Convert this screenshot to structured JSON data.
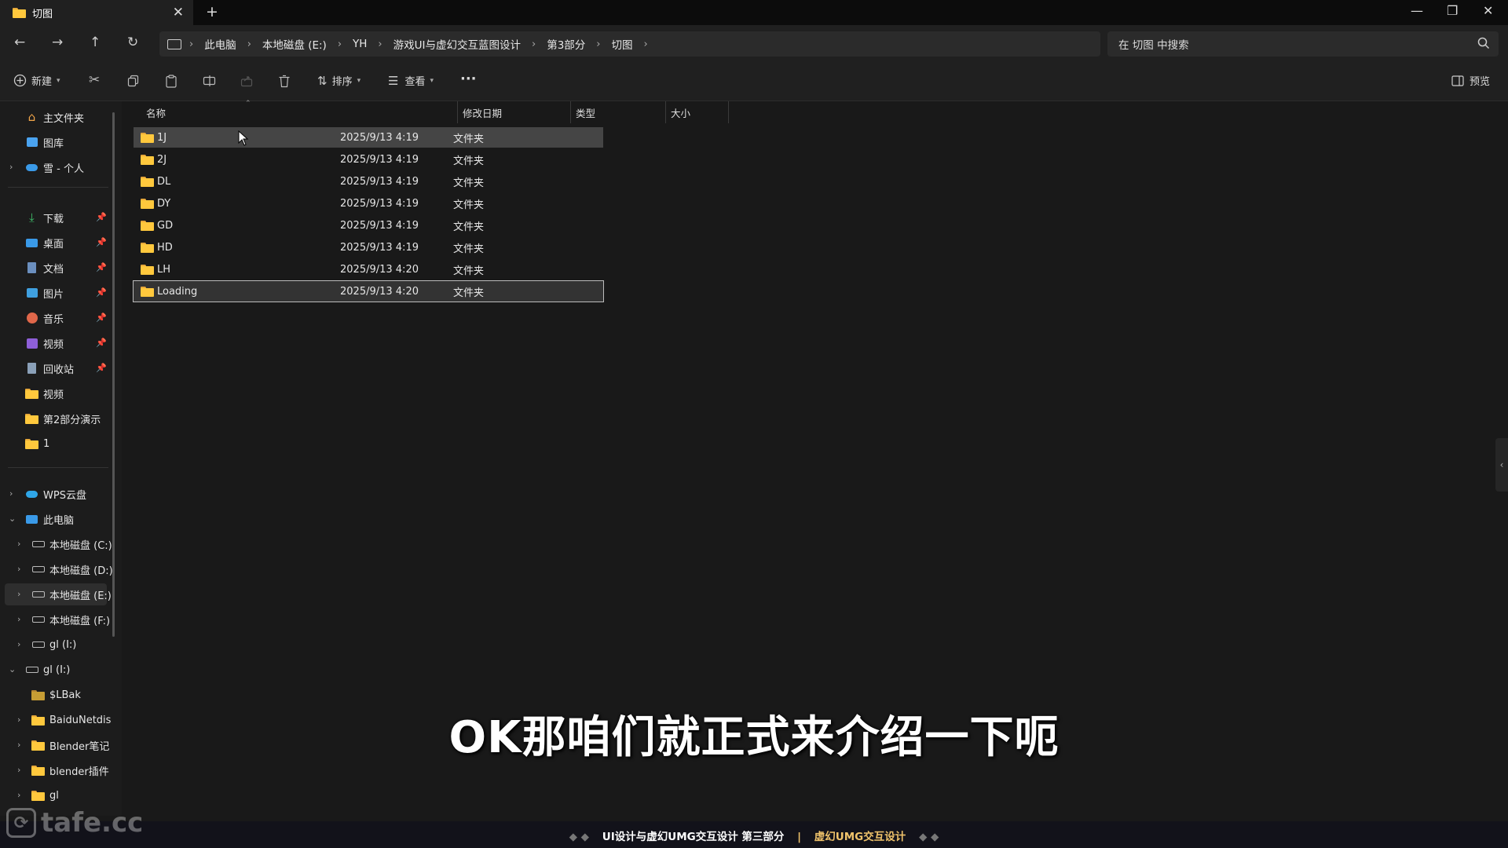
{
  "tab": {
    "title": "切图",
    "close": "✕",
    "new": "+"
  },
  "window_controls": {
    "minimize": "—",
    "restore": "❐",
    "close": "✕"
  },
  "nav": {
    "back": "←",
    "forward": "→",
    "up": "↑",
    "refresh": "↻"
  },
  "breadcrumb": {
    "items": [
      "此电脑",
      "本地磁盘 (E:)",
      "YH",
      "游戏UI与虚幻交互蓝图设计",
      "第3部分",
      "切图"
    ],
    "sep": "›"
  },
  "search": {
    "placeholder": "在 切图 中搜索"
  },
  "toolbar": {
    "new_label": "新建",
    "sort_label": "排序",
    "view_label": "查看",
    "more_label": "···",
    "preview_label": "预览"
  },
  "sidebar": {
    "quick": [
      {
        "label": "主文件夹",
        "icon": "home-icon"
      },
      {
        "label": "图库",
        "icon": "gallery-icon"
      },
      {
        "label": "雪 - 个人",
        "icon": "cloud-icon"
      }
    ],
    "pinned": [
      {
        "label": "下载",
        "icon": "download-icon"
      },
      {
        "label": "桌面",
        "icon": "desktop-icon"
      },
      {
        "label": "文档",
        "icon": "documents-icon"
      },
      {
        "label": "图片",
        "icon": "pictures-icon"
      },
      {
        "label": "音乐",
        "icon": "music-icon"
      },
      {
        "label": "视频",
        "icon": "videos-icon"
      },
      {
        "label": "回收站",
        "icon": "recycle-bin-icon"
      }
    ],
    "folders": [
      {
        "label": "视频"
      },
      {
        "label": "第2部分演示"
      },
      {
        "label": "1"
      }
    ],
    "tree": [
      {
        "label": "WPS云盘",
        "icon": "wps-cloud-icon"
      },
      {
        "label": "此电脑",
        "icon": "this-pc-icon"
      },
      {
        "label": "本地磁盘 (C:)",
        "icon": "drive-icon"
      },
      {
        "label": "本地磁盘 (D:)",
        "icon": "drive-icon"
      },
      {
        "label": "本地磁盘 (E:)",
        "icon": "drive-icon"
      },
      {
        "label": "本地磁盘 (F:)",
        "icon": "drive-icon"
      },
      {
        "label": "gl (I:)",
        "icon": "drive-icon"
      },
      {
        "label": "gl (I:)",
        "icon": "drive-icon"
      },
      {
        "label": "$LBak",
        "icon": "folder-icon"
      },
      {
        "label": "BaiduNetdis",
        "icon": "folder-icon"
      },
      {
        "label": "Blender笔记",
        "icon": "folder-icon"
      },
      {
        "label": "blender插件",
        "icon": "folder-icon"
      },
      {
        "label": "gl",
        "icon": "folder-icon"
      }
    ]
  },
  "columns": {
    "name": "名称",
    "date": "修改日期",
    "type": "类型",
    "size": "大小"
  },
  "files": [
    {
      "name": "1J",
      "date": "2025/9/13 4:19",
      "type": "文件夹"
    },
    {
      "name": "2J",
      "date": "2025/9/13 4:19",
      "type": "文件夹"
    },
    {
      "name": "DL",
      "date": "2025/9/13 4:19",
      "type": "文件夹"
    },
    {
      "name": "DY",
      "date": "2025/9/13 4:19",
      "type": "文件夹"
    },
    {
      "name": "GD",
      "date": "2025/9/13 4:19",
      "type": "文件夹"
    },
    {
      "name": "HD",
      "date": "2025/9/13 4:19",
      "type": "文件夹"
    },
    {
      "name": "LH",
      "date": "2025/9/13 4:20",
      "type": "文件夹"
    },
    {
      "name": "Loading",
      "date": "2025/9/13 4:20",
      "type": "文件夹"
    }
  ],
  "subtitle": "OK那咱们就正式来介绍一下呃",
  "bottom_banner": {
    "main": "UI设计与虚幻UMG交互设计 第三部分",
    "divider": "|",
    "accent": "虚幻UMG交互设计"
  },
  "watermark": "tafe.cc",
  "colors": {
    "folder": "#ffc83d",
    "accent_text": "#f0c36b",
    "background": "#191919"
  }
}
